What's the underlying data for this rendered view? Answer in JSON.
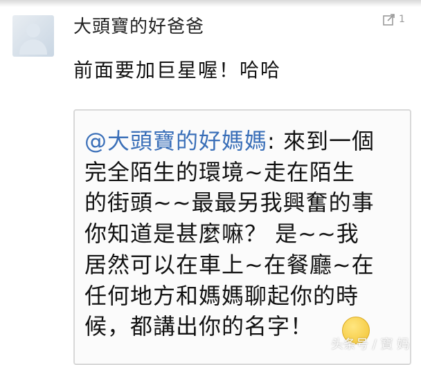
{
  "post": {
    "username": "大頭寶的好爸爸",
    "comment": "前面要加巨星喔！哈哈",
    "share_count": "1"
  },
  "quoted": {
    "mention": "@大頭寶的好媽媽",
    "text": ": 來到一個\n完全陌生的環境~走在陌生\n的街頭~~最最另我興奮的事\n你知道是甚麼嘛？ 是~~我\n居然可以在車上~在餐廳~在\n任何地方和媽媽聊起你的時\n候，都講出你的名字！"
  },
  "watermark": "头条号 / 寶 妈"
}
